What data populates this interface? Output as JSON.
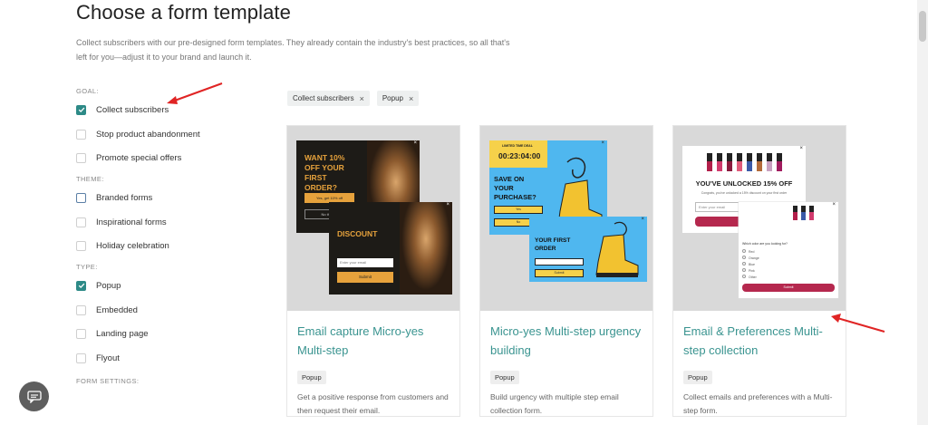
{
  "page": {
    "title": "Choose a form template",
    "description": "Collect subscribers with our pre-designed form templates. They already contain the industry's best practices, so all that's left for you—adjust it to your brand and launch it."
  },
  "sidebar": {
    "groups": [
      {
        "label": "GOAL:",
        "options": [
          {
            "label": "Collect subscribers",
            "checked": true
          },
          {
            "label": "Stop product abandonment",
            "checked": false
          },
          {
            "label": "Promote special offers",
            "checked": false
          }
        ]
      },
      {
        "label": "THEME:",
        "options": [
          {
            "label": "Branded forms",
            "checked": false
          },
          {
            "label": "Inspirational forms",
            "checked": false
          },
          {
            "label": "Holiday celebration",
            "checked": false
          }
        ]
      },
      {
        "label": "TYPE:",
        "options": [
          {
            "label": "Popup",
            "checked": true
          },
          {
            "label": "Embedded",
            "checked": false
          },
          {
            "label": "Landing page",
            "checked": false
          },
          {
            "label": "Flyout",
            "checked": false
          }
        ]
      }
    ],
    "settings_label": "FORM SETTINGS:"
  },
  "filters": [
    {
      "label": "Collect subscribers"
    },
    {
      "label": "Popup"
    }
  ],
  "filter_remove_glyph": "×",
  "cards": [
    {
      "title": "Email capture Micro-yes Multi-step",
      "badge": "Popup",
      "description": "Get a positive response from customers and then request their email.",
      "preview": {
        "headline": "WANT 10% OFF YOUR FIRST ORDER?",
        "cta_yes": "Yes, get 10% off",
        "cta_no": "No thanks",
        "headline2": "DISCOUNT",
        "email_placeholder": "Enter your email",
        "submit": "Submit"
      }
    },
    {
      "title": "Micro-yes Multi-step urgency building",
      "badge": "Popup",
      "description": "Build urgency with multiple step email collection form.",
      "preview": {
        "kicker": "LIMITED TIME DEAL",
        "timer": "00:23:04:00",
        "headline": "SAVE ON YOUR PURCHASE?",
        "yes": "Yes",
        "no": "No",
        "headline2": "YOUR FIRST ORDER",
        "submit": "Submit"
      }
    },
    {
      "title": "Email & Preferences Multi-step collection",
      "badge": "Popup",
      "description": "Collect emails and preferences with a Multi-step form.",
      "preview": {
        "headline": "YOU'VE UNLOCKED 15% OFF",
        "sub": "Congrats, you've unlocked a 15% discount on your first order",
        "email_placeholder": "Enter your email",
        "cta": "GET 15% OFF",
        "question": "Which color are you looking for?",
        "choices": [
          "Red",
          "Orange",
          "Blue",
          "Pink",
          "Other"
        ],
        "submit": "Submit"
      }
    }
  ],
  "colors": {
    "accent": "#2d8a87",
    "title_link": "#3a9490",
    "annotation_arrow": "#e02424"
  },
  "icons": {
    "chat": "chat-bubble-icon",
    "close": "close-icon",
    "check": "check-icon"
  }
}
